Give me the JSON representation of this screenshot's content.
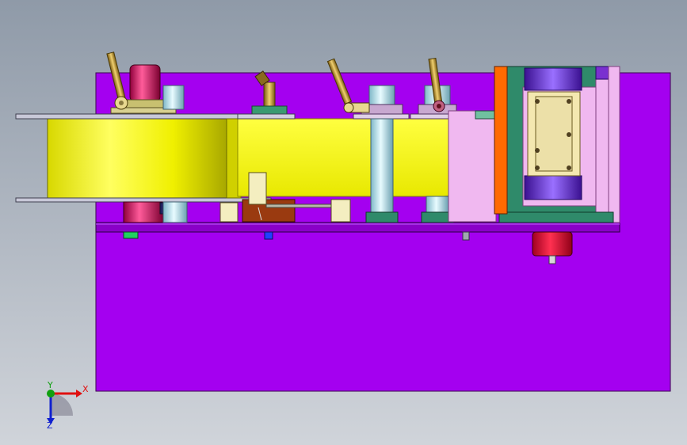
{
  "viewport": {
    "background_top": "#8f9aa8",
    "background_bottom": "#d0d4da"
  },
  "model": {
    "base_plate_color": "#a400f0",
    "reel_color": "#e8e800",
    "belt_color": "#ffff00",
    "motor_color": "#c8005a",
    "roller_color": "#c0e8f0",
    "frame_color": "#2f8a6a",
    "bracket_color": "#ff6a00",
    "cylinder_color": "#6a2ad0",
    "lever_color": "#b89628"
  },
  "triad": {
    "x_label": "X",
    "y_label": "Y",
    "z_label": "Z",
    "x_color": "#e01010",
    "y_color": "#10a010",
    "z_color": "#1020d0"
  }
}
